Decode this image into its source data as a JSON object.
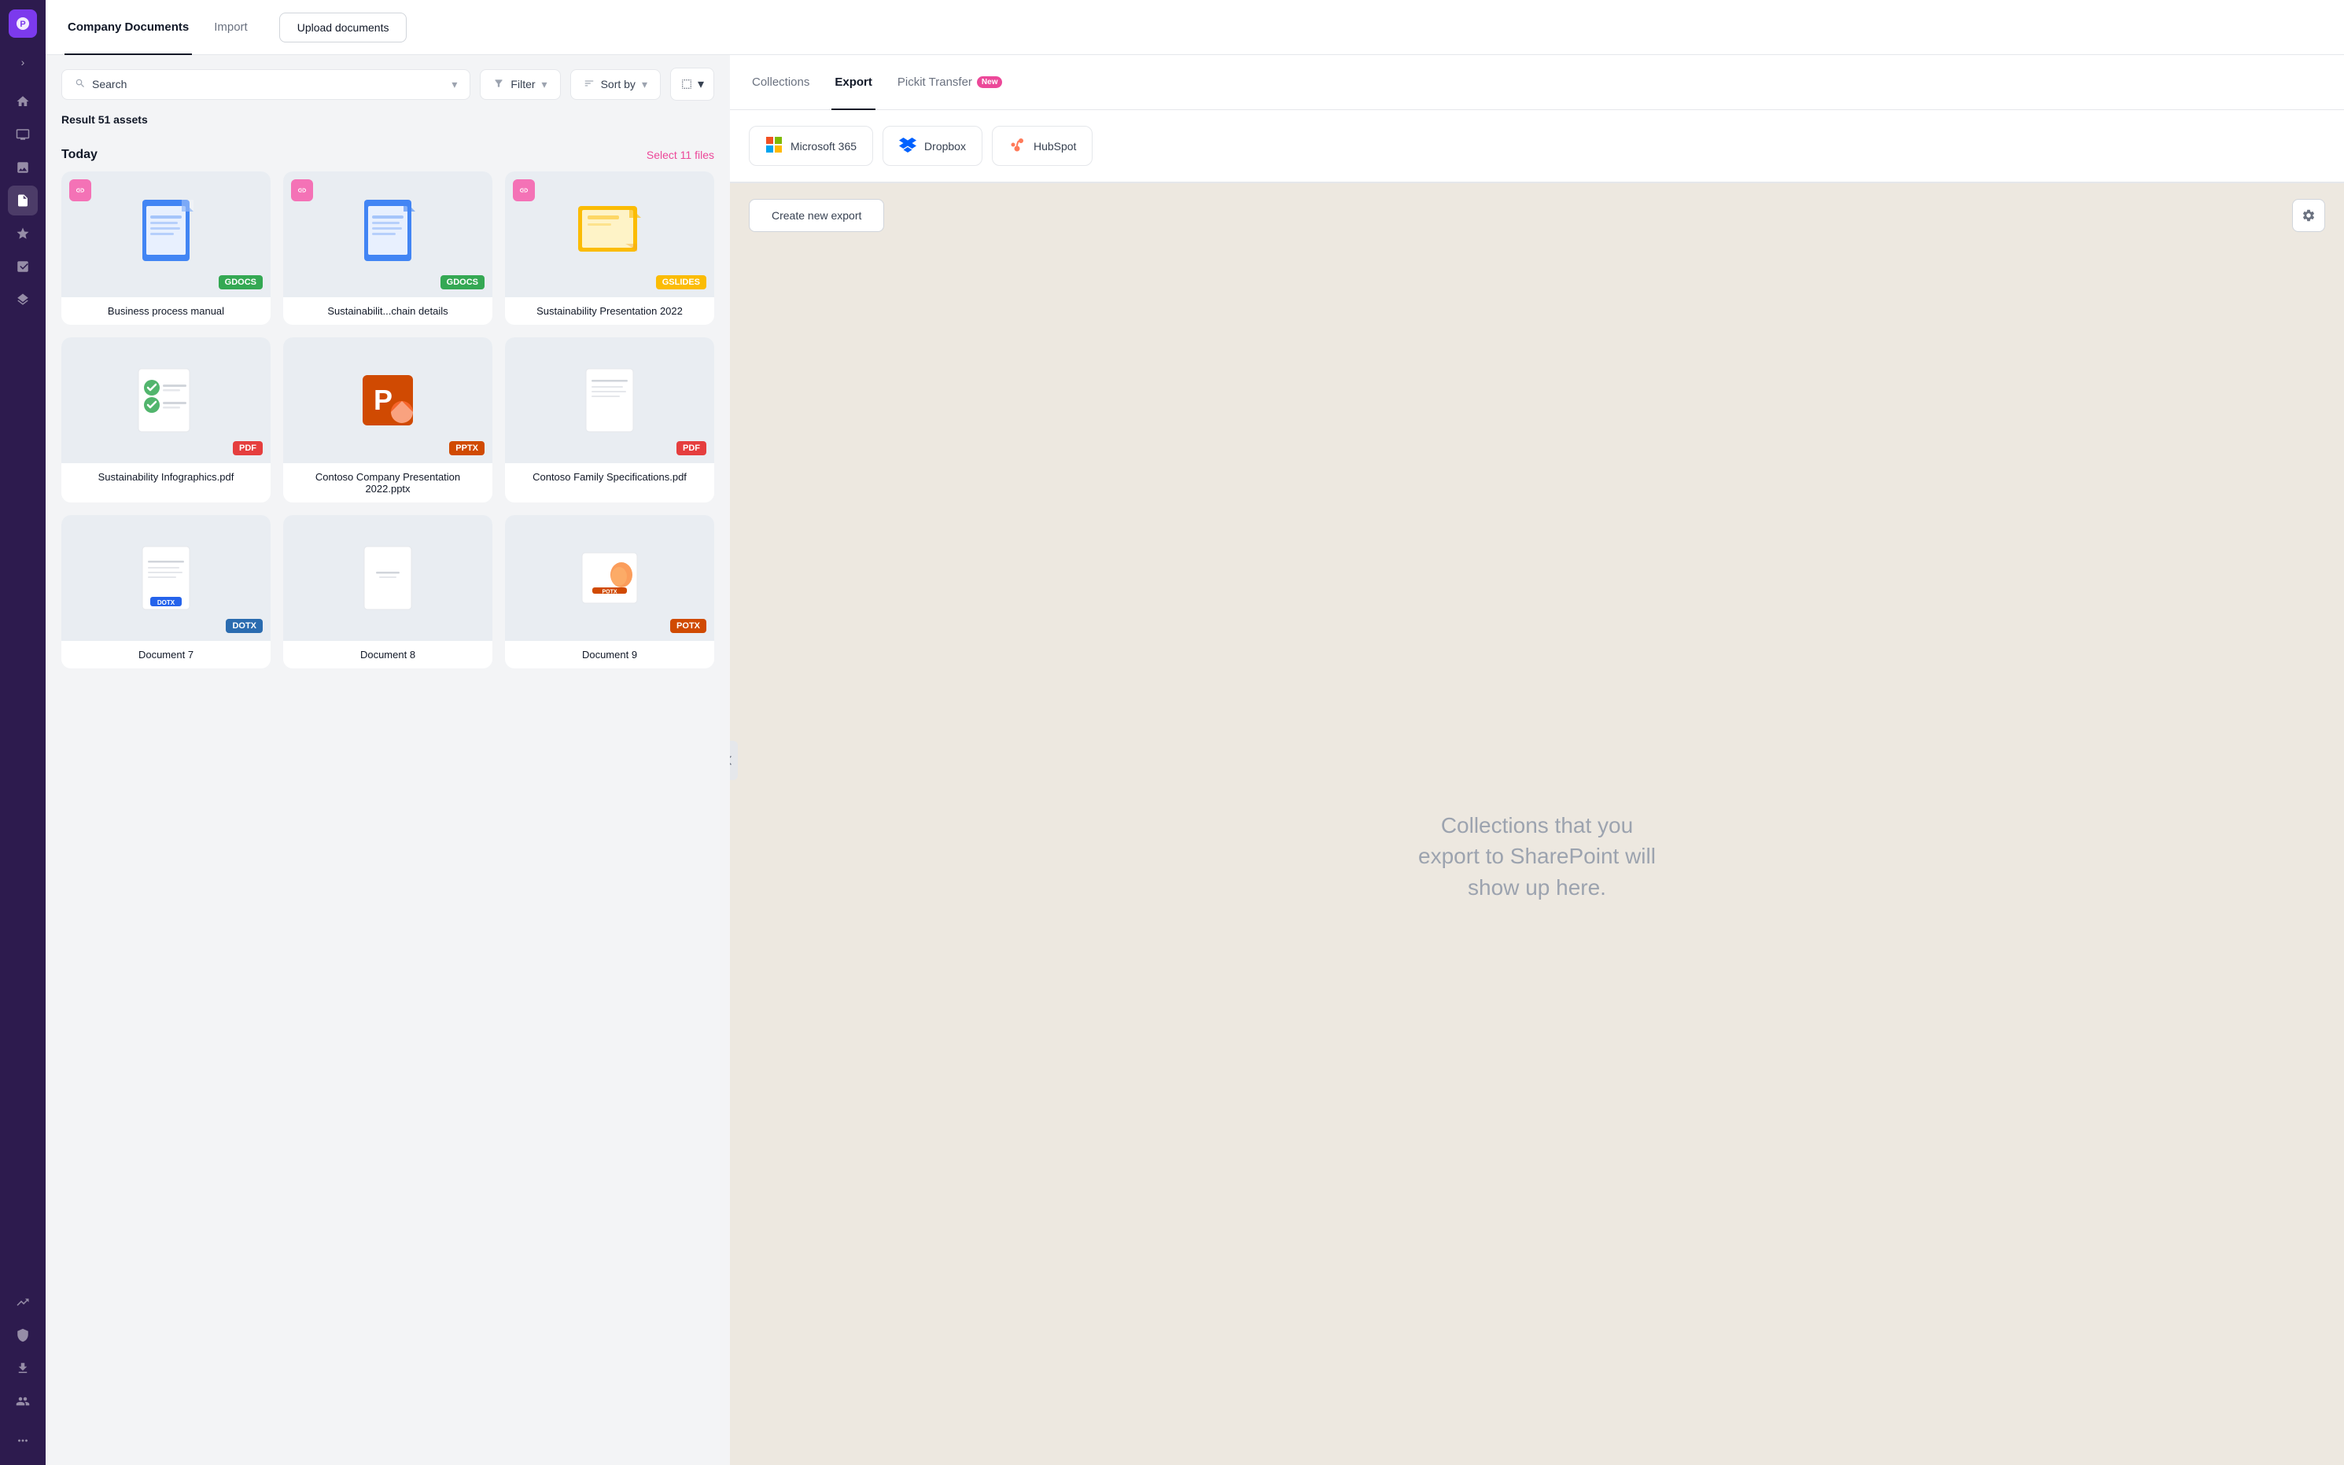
{
  "sidebar": {
    "logo": "P",
    "nav_items": [
      {
        "id": "home",
        "icon": "⌂",
        "active": false
      },
      {
        "id": "monitor",
        "icon": "▭",
        "active": false
      },
      {
        "id": "image",
        "icon": "◫",
        "active": false
      },
      {
        "id": "document",
        "icon": "📄",
        "active": true
      },
      {
        "id": "star",
        "icon": "✦",
        "active": false
      },
      {
        "id": "chart",
        "icon": "⬛",
        "active": false
      },
      {
        "id": "layers",
        "icon": "◈",
        "active": false
      }
    ],
    "bottom_items": [
      {
        "id": "trending",
        "icon": "↗"
      },
      {
        "id": "shield",
        "icon": "◉"
      },
      {
        "id": "export",
        "icon": "⊞"
      },
      {
        "id": "users",
        "icon": "👤"
      },
      {
        "id": "more",
        "icon": "⋯"
      }
    ]
  },
  "header": {
    "tabs": [
      {
        "label": "Company Documents",
        "active": true
      },
      {
        "label": "Import",
        "active": false
      }
    ],
    "upload_button": "Upload documents"
  },
  "toolbar": {
    "search_placeholder": "Search",
    "filter_label": "Filter",
    "sortby_label": "Sort by",
    "view_icon": "⊞"
  },
  "results": {
    "label": "Result",
    "count": "51 assets"
  },
  "sections": [
    {
      "title": "Today",
      "select_link": "Select 11 files",
      "documents": [
        {
          "name": "Business process manual",
          "type": "GDOCS",
          "badge_class": "badge-gdocs",
          "icon_type": "gdoc",
          "has_link": true
        },
        {
          "name": "Sustainabilit...chain details",
          "type": "GDOCS",
          "badge_class": "badge-gdocs",
          "icon_type": "gdoc",
          "has_link": true
        },
        {
          "name": "Sustainability Presentation 2022",
          "type": "GSLIDES",
          "badge_class": "badge-gslides",
          "icon_type": "gslide",
          "has_link": true
        },
        {
          "name": "Sustainability Infographics.pdf",
          "type": "PDF",
          "badge_class": "badge-pdf",
          "icon_type": "pdf",
          "has_link": false
        },
        {
          "name": "Contoso Company Presentation 2022.pptx",
          "type": "PPTX",
          "badge_class": "badge-pptx",
          "icon_type": "pptx",
          "has_link": false
        },
        {
          "name": "Contoso Family Specifications.pdf",
          "type": "PDF",
          "badge_class": "badge-pdf",
          "icon_type": "pdf",
          "has_link": false
        },
        {
          "name": "Document 7",
          "type": "DOTX",
          "badge_class": "badge-dotx",
          "icon_type": "dotx",
          "has_link": false
        },
        {
          "name": "Document 8",
          "type": "",
          "badge_class": "",
          "icon_type": "plain",
          "has_link": false
        },
        {
          "name": "Document 9",
          "type": "POTX",
          "badge_class": "badge-potx",
          "icon_type": "potx",
          "has_link": false
        }
      ]
    }
  ],
  "export_panel": {
    "tabs": [
      {
        "label": "Collections",
        "active": false
      },
      {
        "label": "Export",
        "active": true
      },
      {
        "label": "Pickit Transfer",
        "active": false,
        "badge": "New"
      }
    ],
    "integrations": [
      {
        "id": "microsoft365",
        "label": "Microsoft 365",
        "icon_type": "ms365"
      },
      {
        "id": "dropbox",
        "label": "Dropbox",
        "icon_type": "dropbox"
      },
      {
        "id": "hubspot",
        "label": "HubSpot",
        "icon_type": "hubspot"
      }
    ],
    "create_export_label": "Create new export",
    "settings_icon": "⚙",
    "empty_state_text": "Collections that you export to SharePoint will show up here."
  }
}
